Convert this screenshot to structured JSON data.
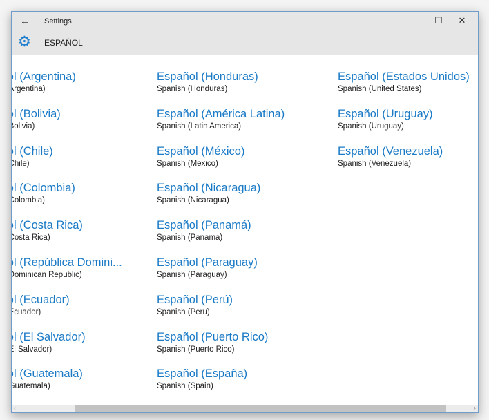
{
  "window": {
    "title": "Settings",
    "back_icon": "arrow-left-icon",
    "minimize": "–",
    "maximize": "☐",
    "close": "✕"
  },
  "header": {
    "icon": "gear-icon",
    "title": "ESPAÑOL"
  },
  "columns": [
    [
      {
        "name": "Español (Argentina)",
        "sub": "Spanish (Argentina)"
      },
      {
        "name": "Español (Bolivia)",
        "sub": "Spanish (Bolivia)"
      },
      {
        "name": "Español (Chile)",
        "sub": "Spanish (Chile)"
      },
      {
        "name": "Español (Colombia)",
        "sub": "Spanish (Colombia)"
      },
      {
        "name": "Español (Costa Rica)",
        "sub": "Spanish (Costa Rica)"
      },
      {
        "name": "Español (República Domini...",
        "sub": "Spanish (Dominican Republic)"
      },
      {
        "name": "Español (Ecuador)",
        "sub": "Spanish (Ecuador)"
      },
      {
        "name": "Español (El Salvador)",
        "sub": "Spanish (El Salvador)"
      },
      {
        "name": "Español (Guatemala)",
        "sub": "Spanish (Guatemala)"
      }
    ],
    [
      {
        "name": "Español (Honduras)",
        "sub": "Spanish (Honduras)"
      },
      {
        "name": "Español (América Latina)",
        "sub": "Spanish (Latin America)"
      },
      {
        "name": "Español (México)",
        "sub": "Spanish (Mexico)"
      },
      {
        "name": "Español (Nicaragua)",
        "sub": "Spanish (Nicaragua)"
      },
      {
        "name": "Español (Panamá)",
        "sub": "Spanish (Panama)"
      },
      {
        "name": "Español (Paraguay)",
        "sub": "Spanish (Paraguay)"
      },
      {
        "name": "Español (Perú)",
        "sub": "Spanish (Peru)"
      },
      {
        "name": "Español (Puerto Rico)",
        "sub": "Spanish (Puerto Rico)"
      },
      {
        "name": "Español (España)",
        "sub": "Spanish (Spain)"
      }
    ],
    [
      {
        "name": "Español (Estados Unidos)",
        "sub": "Spanish (United States)"
      },
      {
        "name": "Español (Uruguay)",
        "sub": "Spanish (Uruguay)"
      },
      {
        "name": "Español (Venezuela)",
        "sub": "Spanish (Venezuela)"
      }
    ]
  ],
  "scrollbar": {
    "left_arrow": "‹",
    "right_arrow": "›"
  }
}
